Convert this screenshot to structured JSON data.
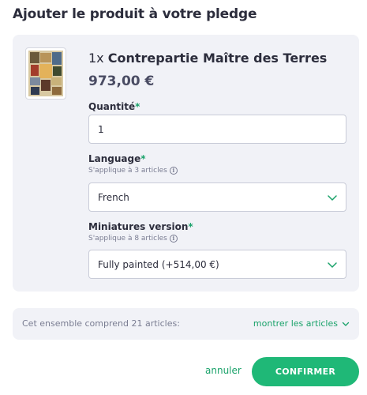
{
  "dialog": {
    "title": "Ajouter le produit à votre pledge",
    "cancel_label": "annuler",
    "confirm_label": "CONFIRMER"
  },
  "product": {
    "quantity_prefix": "1x",
    "name": "Contrepartie Maître des Terres",
    "price": "973,00 €"
  },
  "fields": {
    "quantity": {
      "label": "Quantité",
      "required_mark": "*",
      "value": "1"
    },
    "language": {
      "label": "Language",
      "required_mark": "*",
      "hint": "S'applique à 3 articles",
      "value": "French"
    },
    "miniatures": {
      "label": "Miniatures version",
      "required_mark": "*",
      "hint": "S'applique à 8 articles",
      "value": "Fully painted (+514,00 €)"
    }
  },
  "summary": {
    "text": "Cet ensemble comprend 21 articles:",
    "show_label": "montrer les articles"
  },
  "colors": {
    "accent": "#1fb877",
    "link": "#1aa26a",
    "panel": "#f1f2f7",
    "text": "#2c2d3c"
  },
  "icons": {
    "info": "info-icon",
    "chevron": "chevron-down-icon"
  }
}
